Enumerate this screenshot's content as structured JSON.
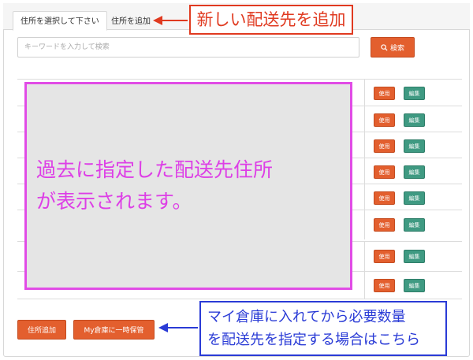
{
  "tabs": [
    {
      "label": "住所を選択して下さい"
    },
    {
      "label": "住所を追加"
    }
  ],
  "search": {
    "placeholder": "キーワードを入力して検索",
    "button_label": "検索",
    "button_icon": "search-icon"
  },
  "address_rows": [
    {
      "use_label": "使用",
      "edit_label": "編集"
    },
    {
      "use_label": "使用",
      "edit_label": "編集"
    },
    {
      "use_label": "使用",
      "edit_label": "編集"
    },
    {
      "use_label": "使用",
      "edit_label": "編集"
    },
    {
      "use_label": "使用",
      "edit_label": "編集"
    },
    {
      "use_label": "使用",
      "edit_label": "編集"
    },
    {
      "use_label": "使用",
      "edit_label": "編集"
    },
    {
      "use_label": "使用",
      "edit_label": "編集"
    }
  ],
  "overlay": {
    "line1": "過去に指定した配送先住所",
    "line2": "が表示されます。"
  },
  "footer": {
    "add_label": "住所追加",
    "keep_label": "My倉庫に一時保管"
  },
  "annotations": {
    "new_address": "新しい配送先を追加",
    "warehouse_line1": "マイ倉庫に入れてから必要数量",
    "warehouse_line2": "を配送先を指定する場合はこちら"
  },
  "colors": {
    "accent_orange": "#e35f2e",
    "edit_green": "#3f9a82",
    "overlay_magenta": "#e14ce6",
    "callout_red": "#e03a20",
    "callout_blue": "#2a3bd6"
  }
}
